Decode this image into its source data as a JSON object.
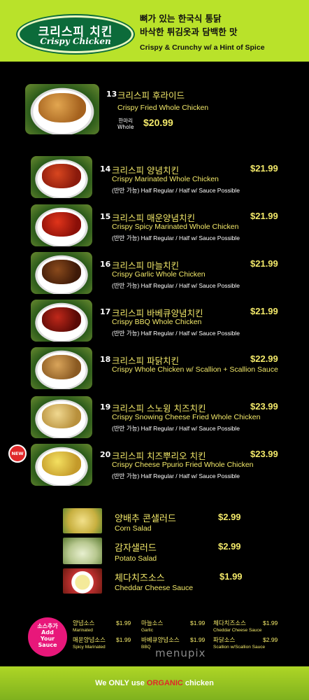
{
  "header": {
    "logo_ko": "크리스피 치킨",
    "logo_en": "Crispy Chicken",
    "tagline_ko_1": "뼈가 있는 한국식 통닭",
    "tagline_ko_2": "바삭한 튀김옷과 담백한 맛",
    "tagline_en": "Crispy & Crunchy w/ a Hint of Spice"
  },
  "items": [
    {
      "num": "13",
      "name_ko": "크리스피 후라이드",
      "name_en": "Crispy Fried Whole Chicken",
      "whole_ko": "한마리",
      "whole_en": "Whole",
      "price": "$20.99"
    },
    {
      "num": "14",
      "name_ko": "크리스피 양념치킨",
      "name_en": "Crispy Marinated Whole Chicken",
      "note": "(반반 가능) Half Regular / Half w/ Sauce Possible",
      "price": "$21.99"
    },
    {
      "num": "15",
      "name_ko": "크리스피 매운양념치킨",
      "name_en": "Crispy Spicy Marinated Whole Chicken",
      "note": "(반반 가능) Half Regular / Half w/ Sauce Possible",
      "price": "$21.99"
    },
    {
      "num": "16",
      "name_ko": "크리스피 마늘치킨",
      "name_en": "Crispy Garlic Whole Chicken",
      "note": "(반반 가능) Half Regular / Half w/ Sauce Possible",
      "price": "$21.99"
    },
    {
      "num": "17",
      "name_ko": "크리스피 바베큐양념치킨",
      "name_en": "Crispy BBQ Whole Chicken",
      "note": "(반반 가능) Half Regular / Half w/ Sauce Possible",
      "price": "$21.99"
    },
    {
      "num": "18",
      "name_ko": "크리스피 파닭치킨",
      "name_en": "Crispy Whole Chicken w/ Scallion + Scallion Sauce",
      "price": "$22.99"
    },
    {
      "num": "19",
      "name_ko": "크리스피 스노윙 치즈치킨",
      "name_en": "Crispy Snowing Cheese Fried  Whole Chicken",
      "note": "(반반 가능) Half Regular / Half w/ Sauce Possible",
      "price": "$23.99"
    },
    {
      "num": "20",
      "name_ko": "크리스피 치즈뿌리오 치킨",
      "name_en": "Crispy Cheese Ppurio Fried  Whole Chicken",
      "note": "(반반 가능) Half Regular / Half w/ Sauce Possible",
      "price": "$23.99",
      "badge": "NEW"
    }
  ],
  "sides": [
    {
      "name_ko": "양배추 콘샐러드",
      "name_en": "Corn Salad",
      "price": "$2.99"
    },
    {
      "name_ko": "감자샐러드",
      "name_en": "Potato  Salad",
      "price": "$2.99"
    },
    {
      "name_ko": "체다치즈소스",
      "name_en": "Cheddar Cheese Sauce",
      "price": "$1.99"
    }
  ],
  "sauce_badge": [
    "소스추가",
    "Add",
    "Your",
    "Sauce"
  ],
  "sauces": [
    {
      "ko": "양념소스",
      "en": "Marinated",
      "price": "$1.99"
    },
    {
      "ko": "마늘소스",
      "en": "Garlic",
      "price": "$1.99"
    },
    {
      "ko": "체다치즈소스",
      "en": "Cheddar Cheese Sauce",
      "price": "$1.99"
    },
    {
      "ko": "매운양념소스",
      "en": "Spicy Marinated",
      "price": "$1.99"
    },
    {
      "ko": "바베큐양념소스",
      "en": "BBQ",
      "price": "$1.99"
    },
    {
      "ko": "파닭소스",
      "en": "Scallion w/Scallion Sauce",
      "price": "$2.99"
    }
  ],
  "watermark": "menupix",
  "footer": {
    "pre": "We ONLY use ",
    "organic": "ORGANIC",
    "post": " chicken"
  },
  "colors": {
    "header_green": "#b9e22a",
    "logo_green": "#0c6b3a",
    "price_yellow": "#f3e96a",
    "new_red": "#e0282a",
    "sauce_pink": "#e8177a"
  }
}
